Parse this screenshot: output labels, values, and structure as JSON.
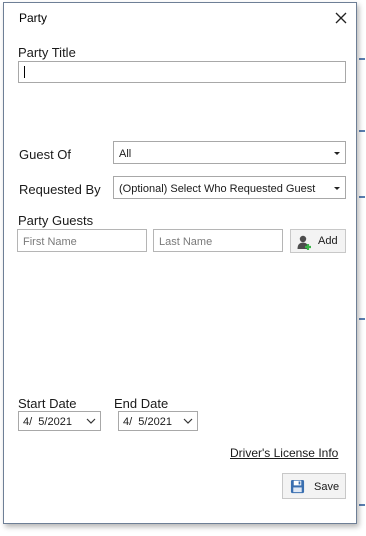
{
  "dialog": {
    "title": "Party",
    "close_icon": "close-icon"
  },
  "party_title": {
    "label": "Party Title",
    "value": ""
  },
  "guest_of": {
    "label": "Guest Of",
    "selected": "All"
  },
  "requested_by": {
    "label": "Requested By",
    "selected": "(Optional) Select Who Requested Guest"
  },
  "party_guests": {
    "label": "Party Guests",
    "first_name_placeholder": "First Name",
    "last_name_placeholder": "Last Name",
    "add_label": "Add",
    "add_icon": "add-user-icon"
  },
  "start_date": {
    "label": "Start Date",
    "value": "4/  5/2021"
  },
  "end_date": {
    "label": "End Date",
    "value": "4/  5/2021"
  },
  "drivers_license_link": "Driver's License Info",
  "save": {
    "label": "Save",
    "icon": "save-icon"
  },
  "colors": {
    "border": "#6e7f96",
    "accent_green": "#3bb54a",
    "icon_blue": "#3a6fb0"
  }
}
